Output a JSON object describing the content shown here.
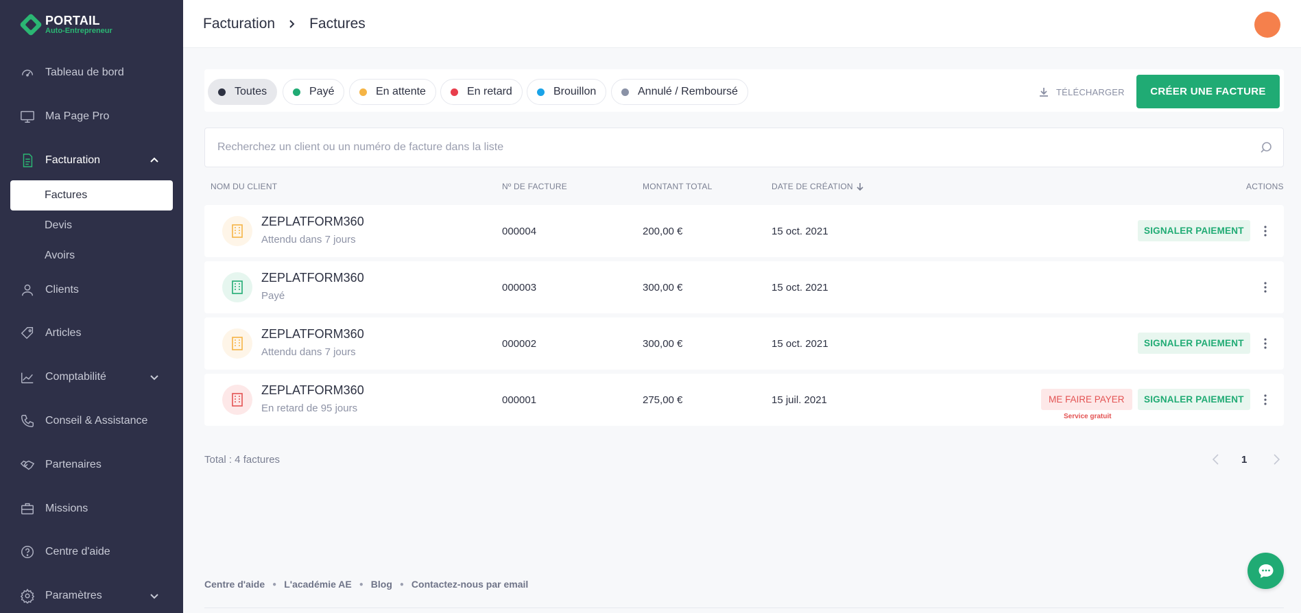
{
  "brand": {
    "title": "PORTAIL",
    "subtitle": "Auto-Entrepreneur",
    "accent": "#20ab74"
  },
  "sidebar": {
    "items": [
      {
        "label": "Tableau de bord",
        "icon": "dashboard-icon"
      },
      {
        "label": "Ma Page Pro",
        "icon": "monitor-icon"
      },
      {
        "label": "Facturation",
        "icon": "document-icon",
        "expanded": true
      },
      {
        "label": "Clients",
        "icon": "user-icon"
      },
      {
        "label": "Articles",
        "icon": "tag-icon"
      },
      {
        "label": "Comptabilité",
        "icon": "chart-icon"
      },
      {
        "label": "Conseil & Assistance",
        "icon": "phone-icon"
      },
      {
        "label": "Partenaires",
        "icon": "handshake-icon"
      },
      {
        "label": "Missions",
        "icon": "briefcase-icon"
      },
      {
        "label": "Centre d'aide",
        "icon": "help-icon"
      },
      {
        "label": "Paramètres",
        "icon": "gear-icon"
      }
    ],
    "subitems": [
      {
        "label": "Factures",
        "selected": true
      },
      {
        "label": "Devis"
      },
      {
        "label": "Avoirs"
      }
    ]
  },
  "header": {
    "breadcrumb": [
      "Facturation",
      "Factures"
    ]
  },
  "filters": [
    {
      "label": "Toutes",
      "color": "#2d3142",
      "active": true
    },
    {
      "label": "Payé",
      "color": "#20ab74"
    },
    {
      "label": "En attente",
      "color": "#f5b445"
    },
    {
      "label": "En retard",
      "color": "#e83e4c"
    },
    {
      "label": "Brouillon",
      "color": "#1aa3e8"
    },
    {
      "label": "Annulé / Remboursé",
      "color": "#8a92a6"
    }
  ],
  "toolbar": {
    "download_label": "TÉLÉCHARGER",
    "create_label": "CRÉER UNE FACTURE"
  },
  "search": {
    "placeholder": "Recherchez un client ou un numéro de facture dans la liste",
    "value": ""
  },
  "table": {
    "columns": {
      "client": "NOM DU CLIENT",
      "number": "Nº DE FACTURE",
      "amount": "MONTANT TOTAL",
      "date": "DATE DE CRÉATION",
      "actions": "ACTIONS"
    },
    "rows": [
      {
        "client": "ZEPLATFORM360",
        "status": "Attendu dans 7 jours",
        "number": "000004",
        "amount": "200,00 €",
        "date": "15 oct. 2021",
        "state": "pending",
        "signal": "SIGNALER PAIEMENT"
      },
      {
        "client": "ZEPLATFORM360",
        "status": "Payé",
        "number": "000003",
        "amount": "300,00 €",
        "date": "15 oct. 2021",
        "state": "paid"
      },
      {
        "client": "ZEPLATFORM360",
        "status": "Attendu dans 7 jours",
        "number": "000002",
        "amount": "300,00 €",
        "date": "15 oct. 2021",
        "state": "pending",
        "signal": "SIGNALER PAIEMENT"
      },
      {
        "client": "ZEPLATFORM360",
        "status": "En retard de 95 jours",
        "number": "000001",
        "amount": "275,00 €",
        "date": "15 juil. 2021",
        "state": "late",
        "signal": "SIGNALER PAIEMENT",
        "pay": "ME FAIRE PAYER",
        "pay_note": "Service gratuit"
      }
    ]
  },
  "total": "Total : 4 factures",
  "pagination": {
    "current": "1"
  },
  "footer": {
    "links": [
      "Centre d'aide",
      "L'académie AE",
      "Blog",
      "Contactez-nous par email"
    ]
  },
  "colors": {
    "pending_bg": "#fef5e8",
    "pending_fg": "#f5b445",
    "paid_bg": "#e6f6ef",
    "paid_fg": "#20ab74",
    "late_bg": "#fde8e8",
    "late_fg": "#e35252"
  }
}
